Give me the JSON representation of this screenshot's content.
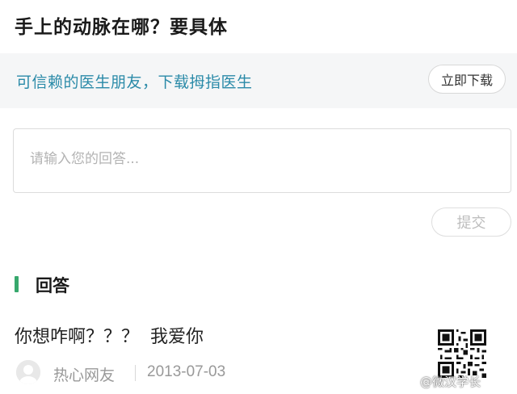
{
  "question": {
    "title": "手上的动脉在哪？要具体"
  },
  "promo": {
    "text": "可信赖的医生朋友，下载拇指医生",
    "download_label": "立即下载"
  },
  "answer_form": {
    "placeholder": "请输入您的回答...",
    "submit_label": "提交"
  },
  "answers_section": {
    "heading": "回答",
    "accent_color": "#37a86d",
    "items": [
      {
        "text": "你想咋啊？？？  我爱你",
        "author": "热心网友",
        "date": "2013-07-03"
      }
    ]
  },
  "watermark": "@微汉学长",
  "colors": {
    "promo_text": "#2a8aa8",
    "promo_background": "#f5f6f7"
  }
}
